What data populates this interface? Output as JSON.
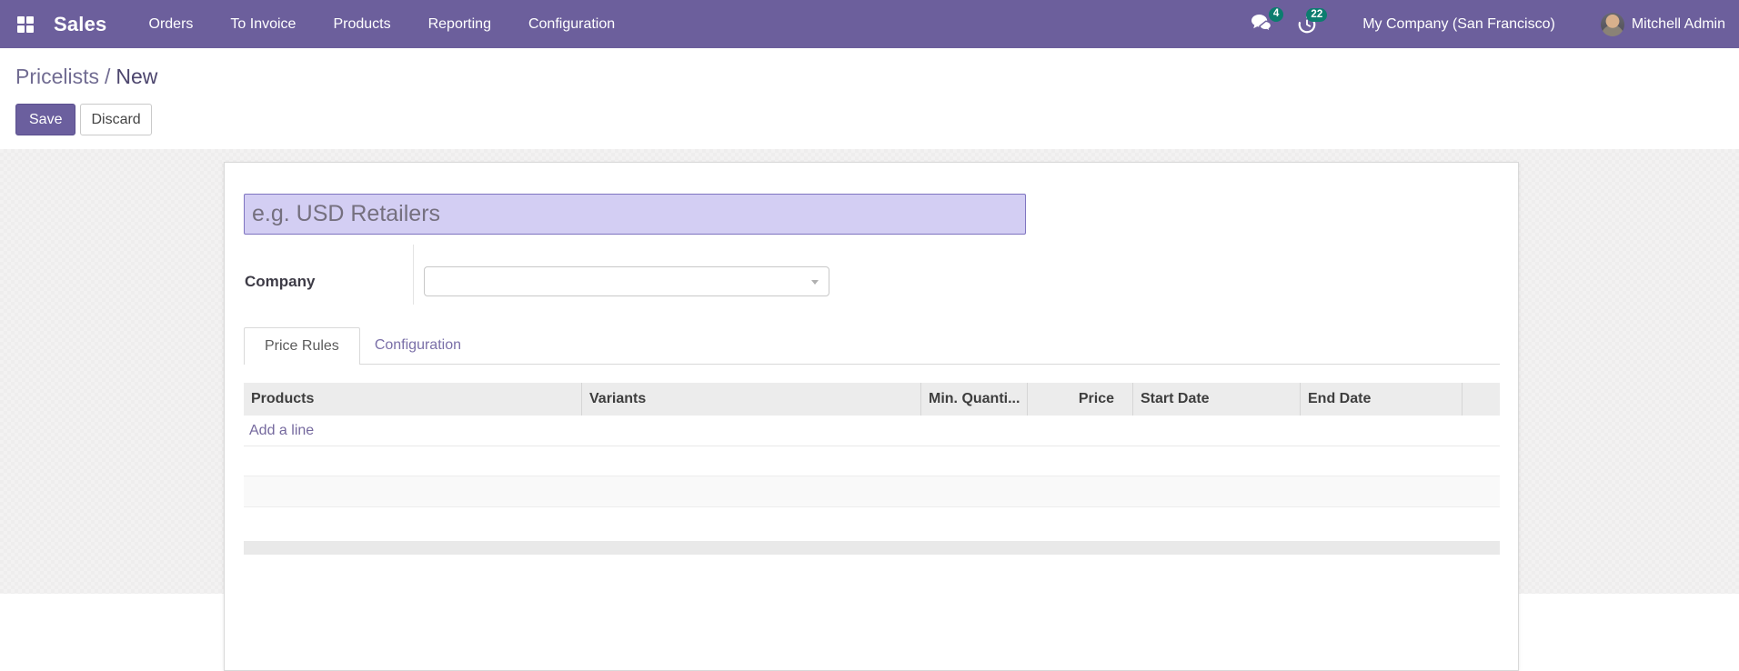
{
  "navbar": {
    "app_name": "Sales",
    "menu_items": [
      "Orders",
      "To Invoice",
      "Products",
      "Reporting",
      "Configuration"
    ],
    "messages_badge": "4",
    "activities_badge": "22",
    "company": "My Company (San Francisco)",
    "user": "Mitchell Admin"
  },
  "breadcrumb": {
    "parent": "Pricelists",
    "separator": "/",
    "current": "New"
  },
  "actions": {
    "save": "Save",
    "discard": "Discard"
  },
  "form": {
    "name_placeholder": "e.g. USD Retailers",
    "name_value": "",
    "company_label": "Company",
    "company_value": "",
    "tabs": [
      {
        "label": "Price Rules",
        "active": true
      },
      {
        "label": "Configuration",
        "active": false
      }
    ],
    "table": {
      "columns": [
        "Products",
        "Variants",
        "Min. Quanti...",
        "Price",
        "Start Date",
        "End Date",
        ""
      ],
      "add_line_label": "Add a line",
      "rows": []
    }
  },
  "colors": {
    "navbar_bg": "#6c5f9c",
    "badge": "#0c7d6f",
    "save_button": "#6b5f9e",
    "link_purple": "#75699e",
    "input_highlight_bg": "#d3cef3",
    "input_highlight_border": "#7e74c0",
    "table_header_bg": "#ececec"
  }
}
